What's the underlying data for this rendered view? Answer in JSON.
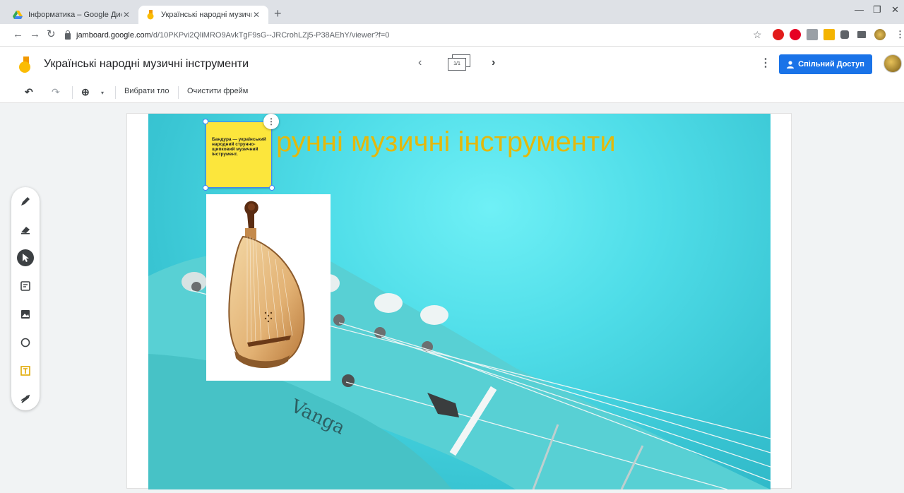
{
  "browser": {
    "tabs": [
      {
        "title": "Інформатика – Google Диск",
        "active": false
      },
      {
        "title": "Українські народні музичні інст",
        "active": true
      }
    ],
    "url_host": "jamboard.google.com",
    "url_path": "/d/10PKPvi2QliMRO9AvkTgF9sG--JRCrohLZj5-P38AEhY/viewer?f=0"
  },
  "app": {
    "title": "Українські народні музичні інструменти",
    "frame_counter": "1/1",
    "share_label": "Спільний Доступ"
  },
  "toolbar": {
    "background_label": "Вибрати тло",
    "clear_label": "Очистити фрейм"
  },
  "frame": {
    "title_text": "рунні музичні інструменти",
    "sticky_text": "Бандура — український народний струнно-щипковий музичний інструмент."
  },
  "colors": {
    "accent": "#1a73e8",
    "sticky": "#fce63c",
    "title": "#e3b80c",
    "frame_bg": "#4fdde8"
  },
  "tools": [
    "pen-icon",
    "eraser-icon",
    "select-icon",
    "sticky-note-icon",
    "image-icon",
    "circle-icon",
    "text-box-icon",
    "laser-icon"
  ]
}
